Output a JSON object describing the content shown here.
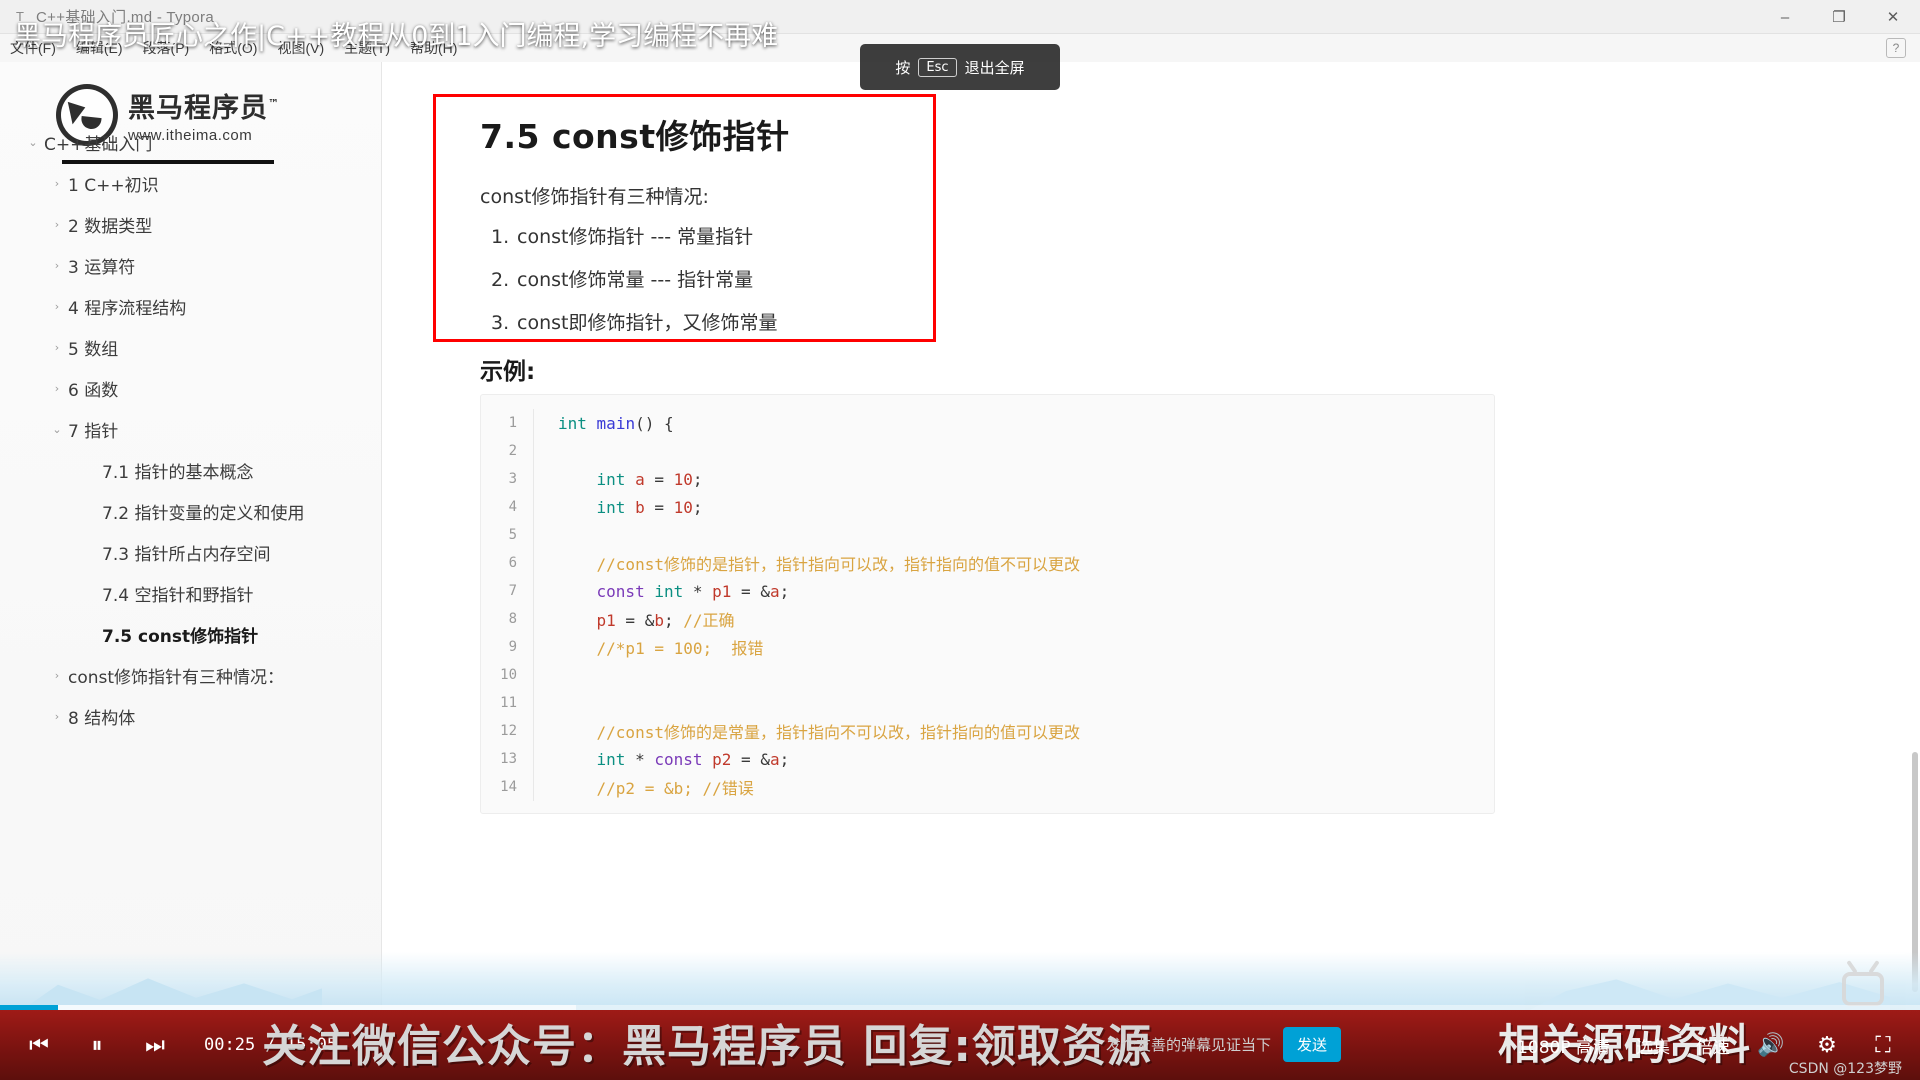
{
  "window": {
    "app_icon": "T",
    "title": "C++基础入门.md - Typora",
    "minimize": "–",
    "maximize": "❐",
    "close": "✕",
    "help_badge": "?"
  },
  "menubar": {
    "items": [
      "文件(F)",
      "编辑(E)",
      "段落(P)",
      "格式(O)",
      "视图(V)",
      "主题(T)",
      "帮助(H)"
    ]
  },
  "video_overlay": {
    "title": "黑马程序员匠心之作|C++教程从0到1入门编程,学习编程不再难",
    "exit_fullscreen_prefix": "按",
    "exit_fullscreen_key": "Esc",
    "exit_fullscreen_suffix": "退出全屏"
  },
  "sidebar": {
    "logo_cn": "黑马程序员",
    "logo_tm": "™",
    "logo_url": "www.itheima.com",
    "outline": [
      {
        "label": "C++基础入门",
        "level": 1,
        "caret": "⌄",
        "active": false
      },
      {
        "label": "1 C++初识",
        "level": 2,
        "caret": "›",
        "active": false
      },
      {
        "label": "2 数据类型",
        "level": 2,
        "caret": "›",
        "active": false
      },
      {
        "label": "3 运算符",
        "level": 2,
        "caret": "›",
        "active": false
      },
      {
        "label": "4 程序流程结构",
        "level": 2,
        "caret": "›",
        "active": false
      },
      {
        "label": "5 数组",
        "level": 2,
        "caret": "›",
        "active": false
      },
      {
        "label": "6 函数",
        "level": 2,
        "caret": "›",
        "active": false
      },
      {
        "label": "7 指针",
        "level": 2,
        "caret": "⌄",
        "active": false
      },
      {
        "label": "7.1 指针的基本概念",
        "level": 3,
        "caret": "",
        "active": false
      },
      {
        "label": "7.2 指针变量的定义和使用",
        "level": 3,
        "caret": "",
        "active": false
      },
      {
        "label": "7.3 指针所占内存空间",
        "level": 3,
        "caret": "",
        "active": false
      },
      {
        "label": "7.4 空指针和野指针",
        "level": 3,
        "caret": "",
        "active": false
      },
      {
        "label": "7.5 const修饰指针",
        "level": 3,
        "caret": "",
        "active": true
      },
      {
        "label": "const修饰指针有三种情况：",
        "level": 2,
        "caret": "›",
        "active": false
      },
      {
        "label": "8 结构体",
        "level": 2,
        "caret": "›",
        "active": false
      }
    ]
  },
  "document": {
    "heading": "7.5 const修饰指针",
    "intro": "const修饰指针有三种情况:",
    "list": [
      {
        "num": "1.",
        "text": "const修饰指针   --- 常量指针"
      },
      {
        "num": "2.",
        "text": "const修饰常量   --- 指针常量"
      },
      {
        "num": "3.",
        "text": "const即修饰指针，又修饰常量"
      }
    ],
    "example_label": "示例:",
    "code_lines": [
      {
        "n": "1",
        "text": "int main() {"
      },
      {
        "n": "2",
        "text": ""
      },
      {
        "n": "3",
        "text": "    int a = 10;"
      },
      {
        "n": "4",
        "text": "    int b = 10;"
      },
      {
        "n": "5",
        "text": ""
      },
      {
        "n": "6",
        "text": "    //const修饰的是指针，指针指向可以改，指针指向的值不可以更改"
      },
      {
        "n": "7",
        "text": "    const int * p1 = &a;"
      },
      {
        "n": "8",
        "text": "    p1 = &b; //正确"
      },
      {
        "n": "9",
        "text": "    //*p1 = 100;  报错"
      },
      {
        "n": "10",
        "text": ""
      },
      {
        "n": "11",
        "text": ""
      },
      {
        "n": "12",
        "text": "    //const修饰的是常量，指针指向不可以改，指针指向的值可以更改"
      },
      {
        "n": "13",
        "text": "    int * const p2 = &a;"
      },
      {
        "n": "14",
        "text": "    //p2 = &b; //错误"
      }
    ]
  },
  "player": {
    "prev_icon": "⏮",
    "pause_icon": "⏸",
    "next_icon": "⏭",
    "time": "00:25 / 15:05",
    "promo_text": "关注微信公众号：黑马程序员  回复:领取资源",
    "promo_text_2": "相关源码资料",
    "danmu_placeholder": "发个友善的弹幕见证当下",
    "send_label": "发送",
    "quality": "1080P 高清",
    "episodes": "选集",
    "speed": "倍速",
    "volume_icon": "🔊",
    "settings_icon": "⚙",
    "fullscreen_icon": "⛶",
    "watermark": "黑马程序员",
    "csdn": "CSDN @123梦野",
    "progress_percent": 3,
    "buffered_percent": 30,
    "accent_color": "#00a1d6",
    "bar_color": "#7a1310"
  }
}
